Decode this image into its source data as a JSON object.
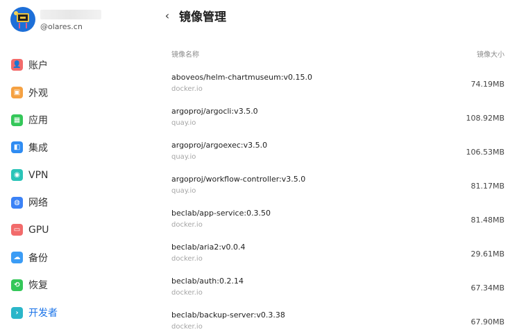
{
  "profile": {
    "domain": "@olares.cn"
  },
  "sidebar": {
    "items": [
      {
        "label": "账户",
        "icon": "account-icon",
        "color": "#f26b6b"
      },
      {
        "label": "外观",
        "icon": "appearance-icon",
        "color": "#f5a142"
      },
      {
        "label": "应用",
        "icon": "apps-icon",
        "color": "#34c759"
      },
      {
        "label": "集成",
        "icon": "integration-icon",
        "color": "#2f8cf2"
      },
      {
        "label": "VPN",
        "icon": "vpn-icon",
        "color": "#2bc4b8"
      },
      {
        "label": "网络",
        "icon": "network-icon",
        "color": "#3b82f6"
      },
      {
        "label": "GPU",
        "icon": "gpu-icon",
        "color": "#f26b6b"
      },
      {
        "label": "备份",
        "icon": "backup-icon",
        "color": "#3b9cf5"
      },
      {
        "label": "恢复",
        "icon": "restore-icon",
        "color": "#34c759"
      },
      {
        "label": "开发者",
        "icon": "developer-icon",
        "color": "#2bb6c9",
        "active": true
      }
    ]
  },
  "header": {
    "back_icon": "chevron-left-icon",
    "title": "镜像管理"
  },
  "table": {
    "col_name": "镜像名称",
    "col_size": "镜像大小",
    "rows": [
      {
        "name": "aboveos/helm-chartmuseum:v0.15.0",
        "source": "docker.io",
        "size": "74.19MB"
      },
      {
        "name": "argoproj/argocli:v3.5.0",
        "source": "quay.io",
        "size": "108.92MB"
      },
      {
        "name": "argoproj/argoexec:v3.5.0",
        "source": "quay.io",
        "size": "106.53MB"
      },
      {
        "name": "argoproj/workflow-controller:v3.5.0",
        "source": "quay.io",
        "size": "81.17MB"
      },
      {
        "name": "beclab/app-service:0.3.50",
        "source": "docker.io",
        "size": "81.48MB"
      },
      {
        "name": "beclab/aria2:v0.0.4",
        "source": "docker.io",
        "size": "29.61MB"
      },
      {
        "name": "beclab/auth:0.2.14",
        "source": "docker.io",
        "size": "67.34MB"
      },
      {
        "name": "beclab/backup-server:v0.3.38",
        "source": "docker.io",
        "size": "67.90MB"
      }
    ]
  }
}
